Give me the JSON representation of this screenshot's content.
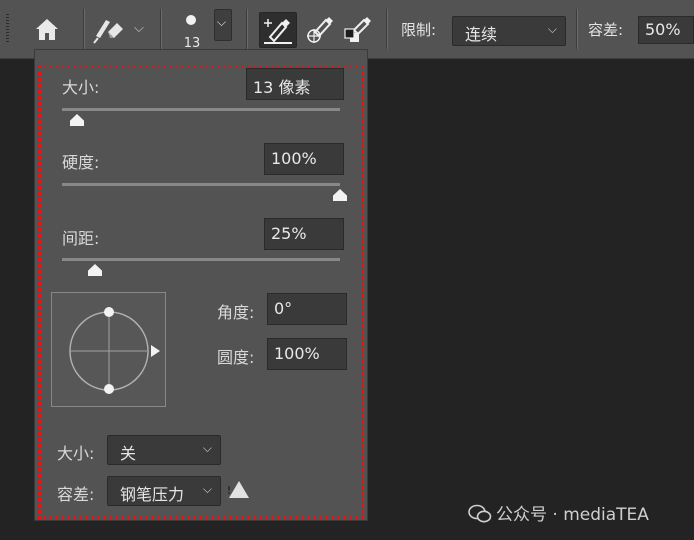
{
  "toolbar": {
    "brush_size": "13",
    "limit_label": "限制:",
    "limit_value": "连续",
    "tolerance_label": "容差:",
    "tolerance_value": "50%",
    "icons": [
      "home-icon",
      "eraser-brush-preset-icon",
      "chevron-down-icon",
      "brush-preview-icon",
      "sampling-continuous-icon",
      "sampling-once-icon",
      "sampling-background-icon"
    ]
  },
  "panel": {
    "size": {
      "label": "大小:",
      "value": "13 像素",
      "slider_fraction": 0.05
    },
    "hardness": {
      "label": "硬度:",
      "value": "100%",
      "slider_fraction": 1.0
    },
    "spacing": {
      "label": "间距:",
      "value": "25%",
      "slider_fraction": 0.12
    },
    "angle": {
      "label": "角度:",
      "value": "0°"
    },
    "roundness": {
      "label": "圆度:",
      "value": "100%"
    },
    "size_control": {
      "label": "大小:",
      "value": "关"
    },
    "tolerance_control": {
      "label": "容差:",
      "value": "钢笔压力"
    }
  },
  "annotation_color": "#e01616",
  "watermark": {
    "text": "公众号 · mediaTEA"
  }
}
